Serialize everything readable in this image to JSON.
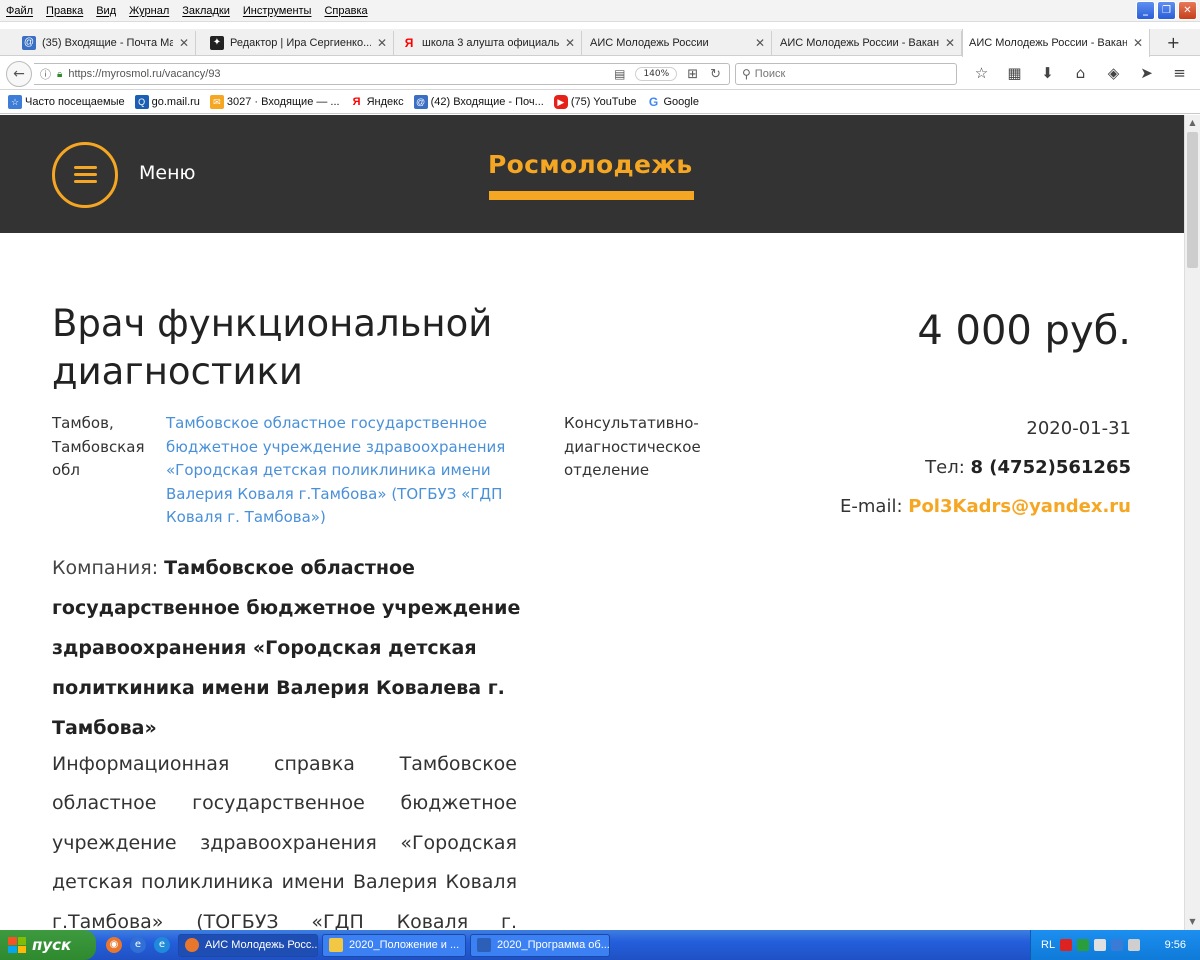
{
  "menubar": {
    "items": [
      "Файл",
      "Правка",
      "Вид",
      "Журнал",
      "Закладки",
      "Инструменты",
      "Справка"
    ]
  },
  "window_controls": {
    "minimize": "_",
    "maximize": "❐",
    "close": "✕"
  },
  "tabs": [
    {
      "label": "(35) Входящие - Почта Mai...",
      "icon": "mail-at-icon",
      "color": "#3a6fc4"
    },
    {
      "label": "Редактор | Ира Сергиенко...",
      "icon": "star-icon",
      "color": "#222222"
    },
    {
      "label": "школа 3 алушта официаль...",
      "icon": "yandex-icon",
      "color": "#ff0000"
    },
    {
      "label": "АИС Молодежь России",
      "icon": "",
      "color": ""
    },
    {
      "label": "АИС Молодежь России - Ваканс...",
      "icon": "",
      "color": ""
    },
    {
      "label": "АИС Молодежь России - Ваканс...",
      "icon": "",
      "color": ""
    }
  ],
  "navbar": {
    "url": "https://myrosmol.ru/vacancy/93",
    "zoom": "140%",
    "search_placeholder": "Поиск"
  },
  "bookmarks": [
    {
      "label": "Часто посещаемые",
      "color": "#3d7dd8",
      "glyph": "☆"
    },
    {
      "label": "go.mail.ru",
      "color": "#1a5fb4",
      "glyph": "Q"
    },
    {
      "label": "3027 · Входящие — ...",
      "color": "#f5a623",
      "glyph": "✉"
    },
    {
      "label": "Яндекс",
      "color": "#ff0000",
      "glyph": "Я"
    },
    {
      "label": "(42) Входящие - Поч...",
      "color": "#3a6fc4",
      "glyph": "@"
    },
    {
      "label": "(75) YouTube",
      "color": "#e62117",
      "glyph": "▶"
    },
    {
      "label": "Google",
      "color": "#4285f4",
      "glyph": "G"
    }
  ],
  "site": {
    "menu_label": "Меню",
    "logo": "Росмолодежь"
  },
  "vacancy": {
    "title": "Врач функциональной диагностики",
    "salary": "4 000 руб.",
    "location": "Тамбов, Тамбовская обл",
    "organization": "Тамбовское областное государственное бюджетное учреждение здравоохранения «Городская детская поликлиника имени Валерия Коваля г.Тамбова» (ТОГБУЗ «ГДП Коваля г. Тамбова»)",
    "department": "Консультативно-диагностическое отделение",
    "date": "2020-01-31",
    "phone_label": "Тел:",
    "phone": "8 (4752)561265",
    "email_label": "E-mail:",
    "email": "Pol3Kadrs@yandex.ru",
    "company_label": "Компания:",
    "company": "Тамбовское областное государственное бюджетное учреждение здравоохранения «Городская детская политкиника имени Валерия Ковалева г. Тамбова»",
    "info": "Информационная справка Тамбовское областное государственное бюджетное учреждение здравоохранения «Городская детская поликлиника имени Валерия Коваля г.Тамбова» (ТОГБУЗ «ГДП Коваля г. Тамбова»)"
  },
  "taskbar": {
    "start_label": "пуск",
    "tasks": [
      {
        "label": "АИС Молодежь Росс...",
        "color": "#e8762d"
      },
      {
        "label": "2020_Положение и ...",
        "color": "#f2c744"
      },
      {
        "label": "2020_Программа об...",
        "color": "#2b5fb8"
      }
    ],
    "tray_lang": "RL",
    "clock": "9:56"
  },
  "colors": {
    "accent": "#f5a623",
    "header_bg": "#333333",
    "link": "#4a90d9"
  }
}
